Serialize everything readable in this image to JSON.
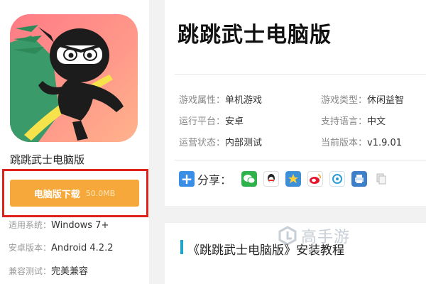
{
  "app": {
    "title": "跳跳武士电脑版",
    "name_under_icon": "跳跳武士电脑版"
  },
  "download": {
    "label": "电脑版下载",
    "size": "50.0MB"
  },
  "specs": [
    {
      "key": "适用系统：",
      "value": "Windows 7+"
    },
    {
      "key": "安卓版本：",
      "value": "Android 4.2.2"
    },
    {
      "key": "兼容测试：",
      "value": "完美兼容"
    }
  ],
  "attributes": {
    "game_attr": {
      "key": "游戏属性：",
      "value": "单机游戏"
    },
    "game_type": {
      "key": "游戏类型：",
      "value": "休闲益智"
    },
    "platform": {
      "key": "运行平台：",
      "value": "安卓"
    },
    "language": {
      "key": "支持语言：",
      "value": "中文"
    },
    "status": {
      "key": "运营状态：",
      "value": "内部测试"
    },
    "version": {
      "key": "当前版本：",
      "value": "v1.9.01"
    }
  },
  "share": {
    "label": "分享：",
    "icons": [
      "wechat-icon",
      "qq-icon",
      "qzone-icon",
      "weibo-icon",
      "tencent-weibo-icon",
      "print-icon",
      "copy-icon"
    ]
  },
  "section": {
    "title": "《跳跳武士电脑版》安装教程"
  },
  "watermark": {
    "text": "高手游"
  },
  "colors": {
    "download_button": "#f6a83a",
    "highlight_border": "#e0201b",
    "section_accent": "#1ea7c4"
  }
}
